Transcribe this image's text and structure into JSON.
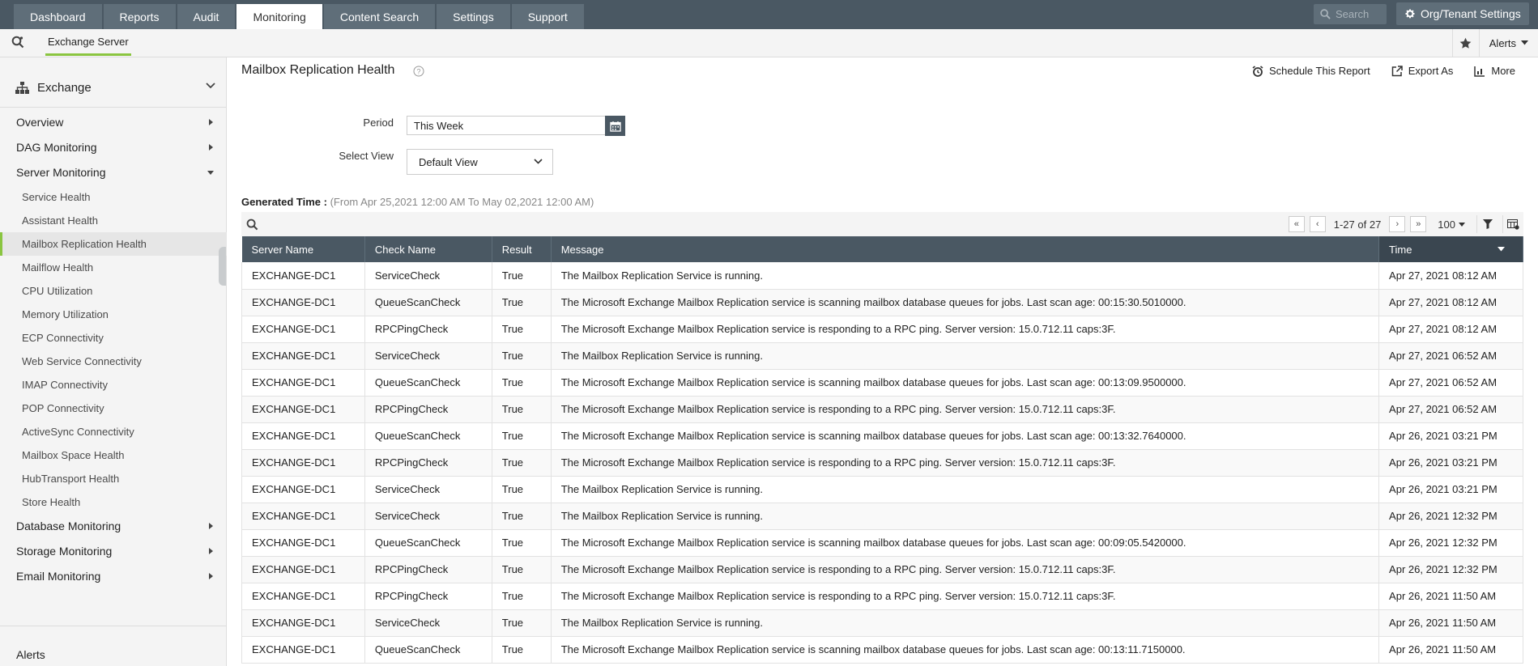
{
  "nav": {
    "tabs": [
      "Dashboard",
      "Reports",
      "Audit",
      "Monitoring",
      "Content Search",
      "Settings",
      "Support"
    ],
    "active_tab": "Monitoring",
    "search_placeholder": "Search",
    "org_settings": "Org/Tenant Settings"
  },
  "subnav": {
    "tab": "Exchange Server",
    "alerts": "Alerts"
  },
  "sidebar": {
    "header": "Exchange",
    "items": [
      {
        "label": "Overview",
        "kind": "top"
      },
      {
        "label": "DAG Monitoring",
        "kind": "top"
      },
      {
        "label": "Server Monitoring",
        "kind": "top-open"
      },
      {
        "label": "Service Health",
        "kind": "sub"
      },
      {
        "label": "Assistant Health",
        "kind": "sub"
      },
      {
        "label": "Mailbox Replication Health",
        "kind": "sub-selected"
      },
      {
        "label": "Mailflow Health",
        "kind": "sub"
      },
      {
        "label": "CPU Utilization",
        "kind": "sub"
      },
      {
        "label": "Memory Utilization",
        "kind": "sub"
      },
      {
        "label": "ECP Connectivity",
        "kind": "sub"
      },
      {
        "label": "Web Service Connectivity",
        "kind": "sub"
      },
      {
        "label": "IMAP Connectivity",
        "kind": "sub"
      },
      {
        "label": "POP Connectivity",
        "kind": "sub"
      },
      {
        "label": "ActiveSync Connectivity",
        "kind": "sub"
      },
      {
        "label": "Mailbox Space Health",
        "kind": "sub"
      },
      {
        "label": "HubTransport Health",
        "kind": "sub"
      },
      {
        "label": "Store Health",
        "kind": "sub"
      },
      {
        "label": "Database Monitoring",
        "kind": "top"
      },
      {
        "label": "Storage Monitoring",
        "kind": "top"
      },
      {
        "label": "Email Monitoring",
        "kind": "top"
      }
    ],
    "bottom": "Alerts"
  },
  "page": {
    "title": "Mailbox Replication Health",
    "actions": {
      "schedule": "Schedule This Report",
      "export": "Export As",
      "more": "More"
    },
    "period_label": "Period",
    "period_value": "This Week",
    "view_label": "Select View",
    "view_value": "Default View",
    "generated_label": "Generated Time :",
    "generated_range": "(From Apr 25,2021 12:00 AM To May 02,2021 12:00 AM)",
    "pagination": "1-27 of 27",
    "per_page": "100"
  },
  "table": {
    "columns": [
      "Server Name",
      "Check Name",
      "Result",
      "Message",
      "Time"
    ],
    "rows": [
      [
        "EXCHANGE-DC1",
        "ServiceCheck",
        "True",
        "The Mailbox Replication Service is running.",
        "Apr 27, 2021 08:12 AM"
      ],
      [
        "EXCHANGE-DC1",
        "QueueScanCheck",
        "True",
        "The Microsoft Exchange Mailbox Replication service is scanning mailbox database queues for jobs. Last scan age: 00:15:30.5010000.",
        "Apr 27, 2021 08:12 AM"
      ],
      [
        "EXCHANGE-DC1",
        "RPCPingCheck",
        "True",
        "The Microsoft Exchange Mailbox Replication service is responding to a RPC ping. Server version: 15.0.712.11 caps:3F.",
        "Apr 27, 2021 08:12 AM"
      ],
      [
        "EXCHANGE-DC1",
        "ServiceCheck",
        "True",
        "The Mailbox Replication Service is running.",
        "Apr 27, 2021 06:52 AM"
      ],
      [
        "EXCHANGE-DC1",
        "QueueScanCheck",
        "True",
        "The Microsoft Exchange Mailbox Replication service is scanning mailbox database queues for jobs. Last scan age: 00:13:09.9500000.",
        "Apr 27, 2021 06:52 AM"
      ],
      [
        "EXCHANGE-DC1",
        "RPCPingCheck",
        "True",
        "The Microsoft Exchange Mailbox Replication service is responding to a RPC ping. Server version: 15.0.712.11 caps:3F.",
        "Apr 27, 2021 06:52 AM"
      ],
      [
        "EXCHANGE-DC1",
        "QueueScanCheck",
        "True",
        "The Microsoft Exchange Mailbox Replication service is scanning mailbox database queues for jobs. Last scan age: 00:13:32.7640000.",
        "Apr 26, 2021 03:21 PM"
      ],
      [
        "EXCHANGE-DC1",
        "RPCPingCheck",
        "True",
        "The Microsoft Exchange Mailbox Replication service is responding to a RPC ping. Server version: 15.0.712.11 caps:3F.",
        "Apr 26, 2021 03:21 PM"
      ],
      [
        "EXCHANGE-DC1",
        "ServiceCheck",
        "True",
        "The Mailbox Replication Service is running.",
        "Apr 26, 2021 03:21 PM"
      ],
      [
        "EXCHANGE-DC1",
        "ServiceCheck",
        "True",
        "The Mailbox Replication Service is running.",
        "Apr 26, 2021 12:32 PM"
      ],
      [
        "EXCHANGE-DC1",
        "QueueScanCheck",
        "True",
        "The Microsoft Exchange Mailbox Replication service is scanning mailbox database queues for jobs. Last scan age: 00:09:05.5420000.",
        "Apr 26, 2021 12:32 PM"
      ],
      [
        "EXCHANGE-DC1",
        "RPCPingCheck",
        "True",
        "The Microsoft Exchange Mailbox Replication service is responding to a RPC ping. Server version: 15.0.712.11 caps:3F.",
        "Apr 26, 2021 12:32 PM"
      ],
      [
        "EXCHANGE-DC1",
        "RPCPingCheck",
        "True",
        "The Microsoft Exchange Mailbox Replication service is responding to a RPC ping. Server version: 15.0.712.11 caps:3F.",
        "Apr 26, 2021 11:50 AM"
      ],
      [
        "EXCHANGE-DC1",
        "ServiceCheck",
        "True",
        "The Mailbox Replication Service is running.",
        "Apr 26, 2021 11:50 AM"
      ],
      [
        "EXCHANGE-DC1",
        "QueueScanCheck",
        "True",
        "The Microsoft Exchange Mailbox Replication service is scanning mailbox database queues for jobs. Last scan age: 00:13:11.7150000.",
        "Apr 26, 2021 11:50 AM"
      ]
    ]
  },
  "colors": {
    "topbar": "#4a5863",
    "accent": "#8ac540"
  }
}
